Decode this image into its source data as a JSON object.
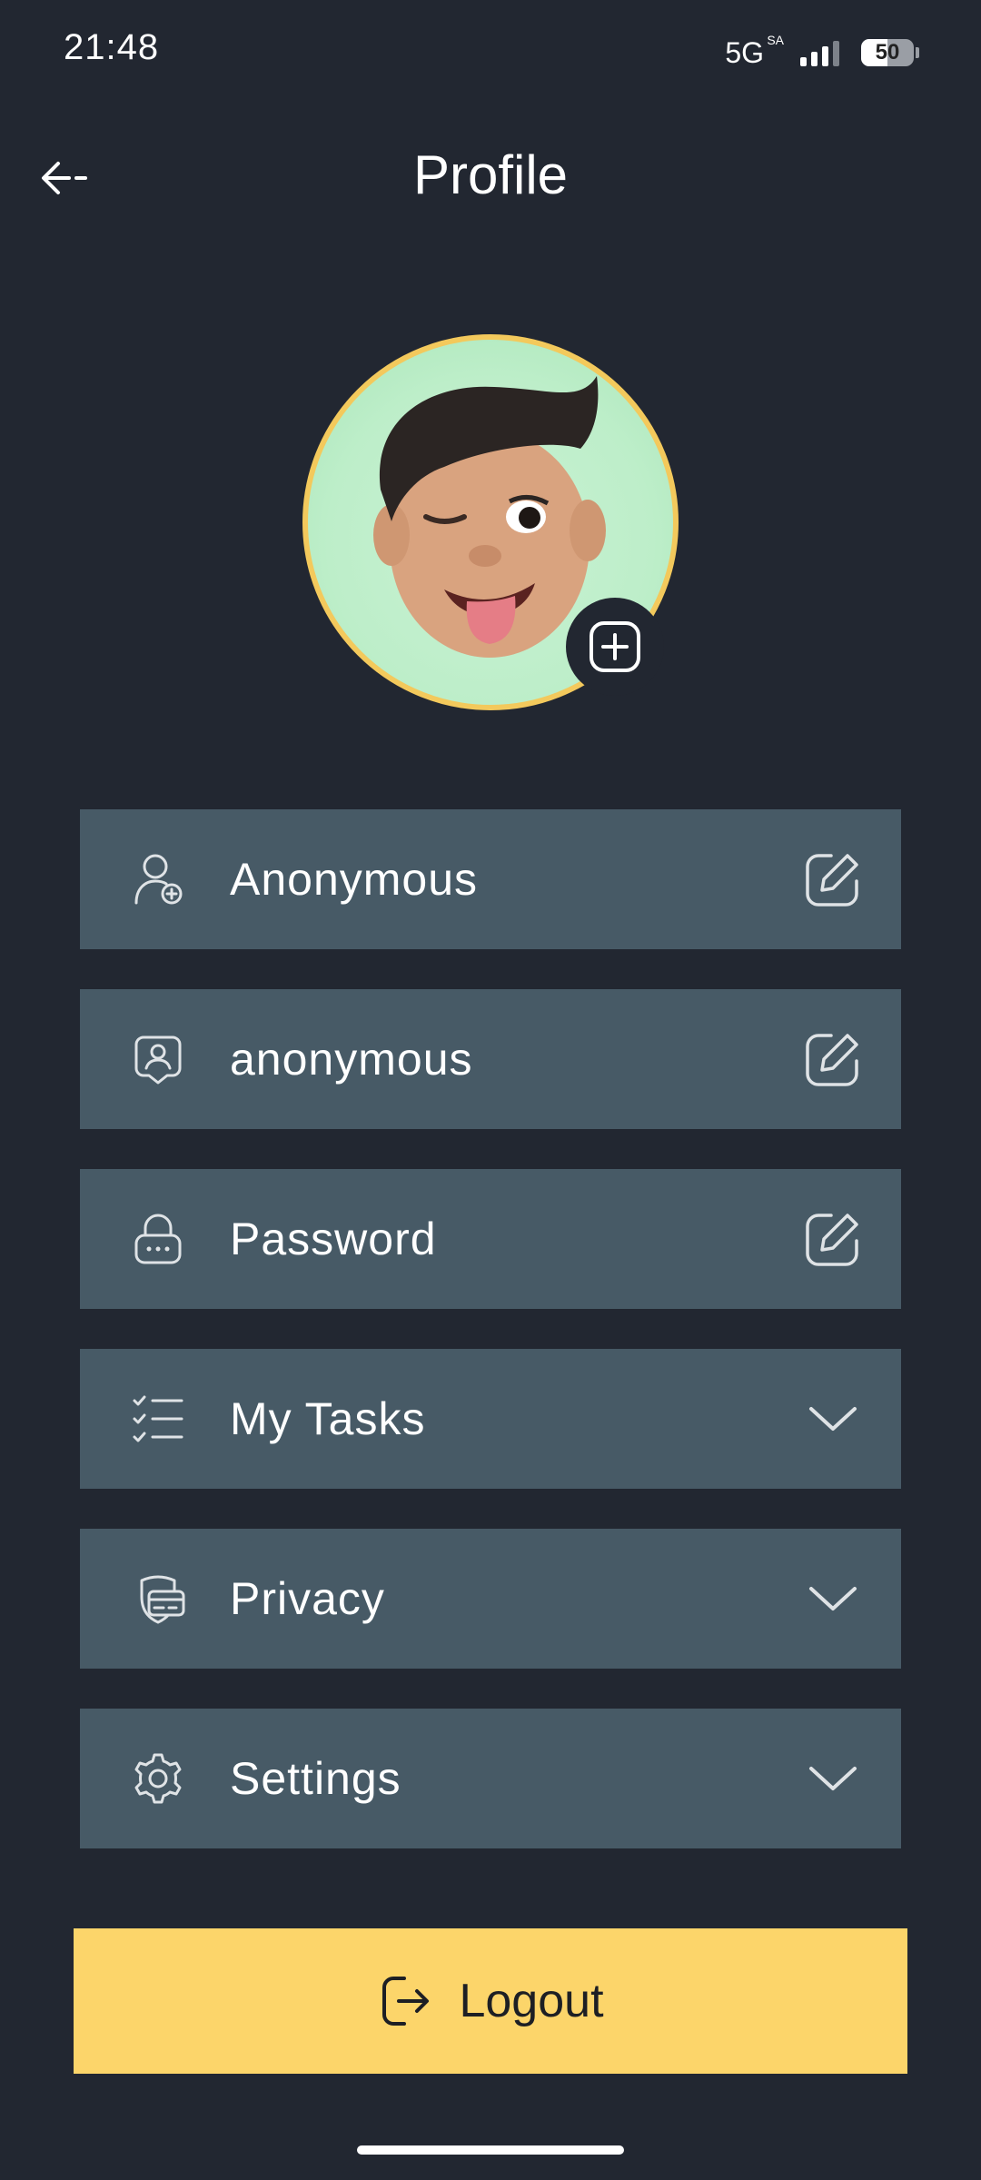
{
  "status_bar": {
    "time": "21:48",
    "network": "5G",
    "network_sup": "SA",
    "signal_bars": 3,
    "battery": "50",
    "battery_level": 0.5
  },
  "header": {
    "title": "Profile",
    "back_icon": "arrow-left-icon"
  },
  "avatar": {
    "image": "memoji-winking-boy",
    "add_icon": "plus-square-icon",
    "border_color": "#f3c95c"
  },
  "menu": {
    "items": [
      {
        "label": "Anonymous",
        "icon": "user-add-icon",
        "action_icon": "edit-icon"
      },
      {
        "label": "anonymous",
        "icon": "id-badge-icon",
        "action_icon": "edit-icon"
      },
      {
        "label": "Password",
        "icon": "lock-icon",
        "action_icon": "edit-icon"
      },
      {
        "label": "My Tasks",
        "icon": "task-list-icon",
        "action_icon": "chevron-down-icon"
      },
      {
        "label": "Privacy",
        "icon": "card-shield-icon",
        "action_icon": "chevron-down-icon"
      },
      {
        "label": "Settings",
        "icon": "gear-icon",
        "action_icon": "chevron-down-icon"
      }
    ]
  },
  "logout": {
    "label": "Logout",
    "icon": "logout-icon"
  },
  "colors": {
    "background": "#222731",
    "card": "#475a66",
    "accent": "#fcd56a",
    "text": "#ffffff"
  }
}
